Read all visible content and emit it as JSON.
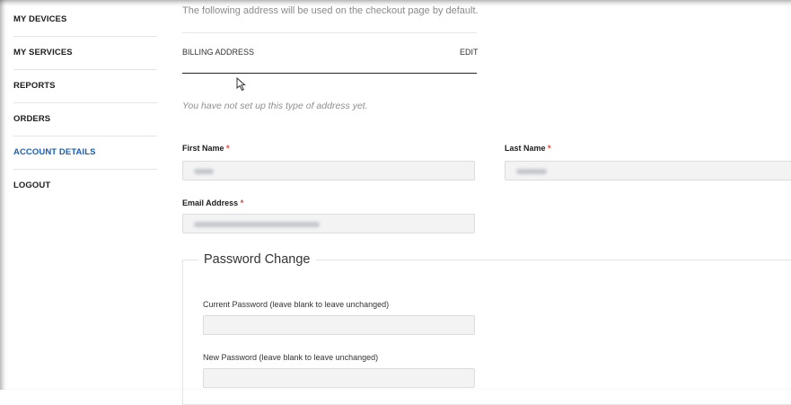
{
  "sidebar": {
    "items": [
      {
        "label": "MY DEVICES"
      },
      {
        "label": "MY SERVICES"
      },
      {
        "label": "REPORTS"
      },
      {
        "label": "ORDERS"
      },
      {
        "label": "ACCOUNT DETAILS",
        "active": true
      },
      {
        "label": "LOGOUT"
      }
    ]
  },
  "address": {
    "intro": "The following address will be used on the checkout page by default.",
    "billing_title": "BILLING ADDRESS",
    "edit_label": "EDIT",
    "empty_message": "You have not set up this type of address yet."
  },
  "form": {
    "first_name_label": "First Name",
    "last_name_label": "Last Name",
    "email_label": "Email Address",
    "required_mark": "*"
  },
  "password": {
    "legend": "Password Change",
    "current_label": "Current Password (leave blank to leave unchanged)",
    "new_label": "New Password (leave blank to leave unchanged)"
  },
  "colors": {
    "active_nav": "#1a5fb4",
    "required": "#e53935"
  }
}
